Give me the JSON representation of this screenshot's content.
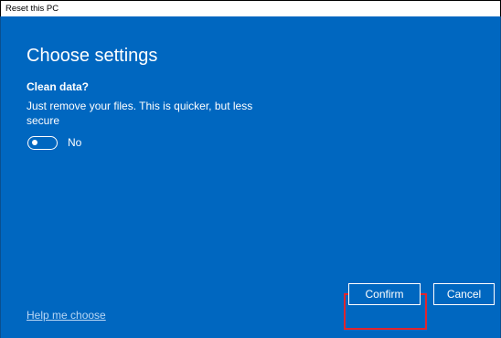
{
  "window": {
    "title": "Reset this PC"
  },
  "page": {
    "heading": "Choose settings",
    "subheading": "Clean data?",
    "description": "Just remove your files. This is quicker, but less secure",
    "toggle": {
      "state": "off",
      "label": "No"
    },
    "help_link": "Help me choose"
  },
  "buttons": {
    "confirm": "Confirm",
    "cancel": "Cancel"
  },
  "colors": {
    "background": "#0067c0",
    "text": "#ffffff",
    "link": "#b9d7f5",
    "highlight": "#e0252e"
  }
}
